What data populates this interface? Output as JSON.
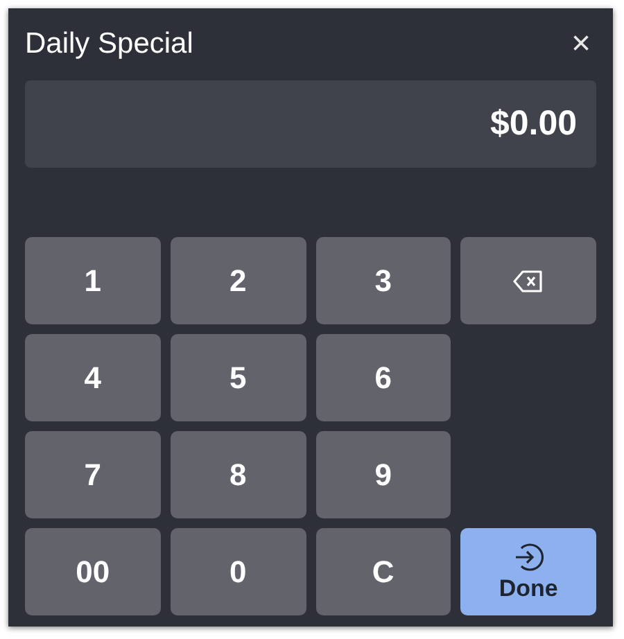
{
  "window": {
    "title": "Daily Special",
    "close": "×"
  },
  "display": {
    "value": "$0.00"
  },
  "keys": [
    {
      "kind": "digit",
      "label": "1"
    },
    {
      "kind": "digit",
      "label": "2"
    },
    {
      "kind": "digit",
      "label": "3"
    },
    {
      "kind": "backspace"
    },
    {
      "kind": "digit",
      "label": "4"
    },
    {
      "kind": "digit",
      "label": "5"
    },
    {
      "kind": "digit",
      "label": "6"
    },
    {
      "kind": "digit",
      "label": "7"
    },
    {
      "kind": "digit",
      "label": "8"
    },
    {
      "kind": "digit",
      "label": "9"
    },
    {
      "kind": "digit",
      "label": "00"
    },
    {
      "kind": "digit",
      "label": "0"
    },
    {
      "kind": "digit",
      "label": "C"
    },
    {
      "kind": "done",
      "label": "Done"
    }
  ]
}
